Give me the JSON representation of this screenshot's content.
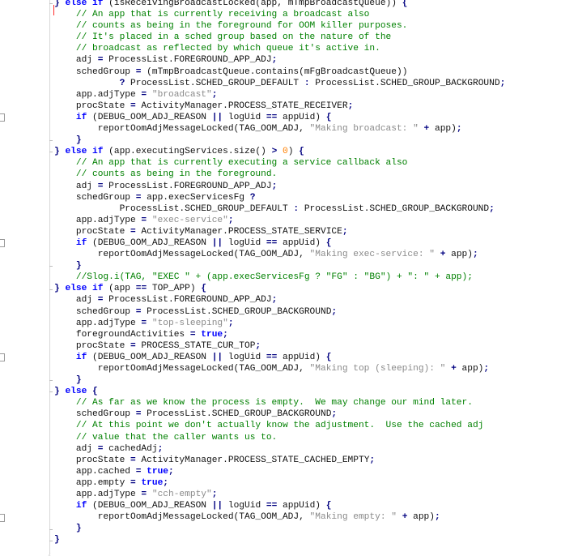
{
  "editor": {
    "gutter_markers": [
      8,
      9,
      10,
      11,
      12,
      13,
      14
    ],
    "lines": [
      [
        [
          "pn",
          "} "
        ],
        [
          "kw",
          "else if"
        ],
        [
          "t",
          " (isReceivingBroadcastLocked(app, mTmpBroadcastQueue)) "
        ],
        [
          "pn",
          "{"
        ]
      ],
      [
        [
          "t",
          "    "
        ],
        [
          "cm",
          "// An app that is currently receiving a broadcast also"
        ]
      ],
      [
        [
          "t",
          "    "
        ],
        [
          "cm",
          "// counts as being in the foreground for OOM killer purposes."
        ]
      ],
      [
        [
          "t",
          "    "
        ],
        [
          "cm",
          "// It's placed in a sched group based on the nature of the"
        ]
      ],
      [
        [
          "t",
          "    "
        ],
        [
          "cm",
          "// broadcast as reflected by which queue it's active in."
        ]
      ],
      [
        [
          "t",
          "    adj "
        ],
        [
          "pn",
          "="
        ],
        [
          "t",
          " ProcessList.FOREGROUND_APP_ADJ"
        ],
        [
          "pn",
          ";"
        ]
      ],
      [
        [
          "t",
          "    schedGroup "
        ],
        [
          "pn",
          "="
        ],
        [
          "t",
          " (mTmpBroadcastQueue.contains(mFgBroadcastQueue))"
        ]
      ],
      [
        [
          "t",
          "            "
        ],
        [
          "pn",
          "?"
        ],
        [
          "t",
          " ProcessList.SCHED_GROUP_DEFAULT "
        ],
        [
          "pn",
          ":"
        ],
        [
          "t",
          " ProcessList.SCHED_GROUP_BACKGROUND"
        ],
        [
          "pn",
          ";"
        ]
      ],
      [
        [
          "t",
          "    app.adjType "
        ],
        [
          "pn",
          "="
        ],
        [
          "t",
          " "
        ],
        [
          "str",
          "\"broadcast\""
        ],
        [
          "pn",
          ";"
        ]
      ],
      [
        [
          "t",
          "    procState "
        ],
        [
          "pn",
          "="
        ],
        [
          "t",
          " ActivityManager.PROCESS_STATE_RECEIVER"
        ],
        [
          "pn",
          ";"
        ]
      ],
      [
        [
          "t",
          "    "
        ],
        [
          "kw",
          "if"
        ],
        [
          "t",
          " (DEBUG_OOM_ADJ_REASON "
        ],
        [
          "pn",
          "||"
        ],
        [
          "t",
          " logUid "
        ],
        [
          "pn",
          "=="
        ],
        [
          "t",
          " appUid) "
        ],
        [
          "pn",
          "{"
        ]
      ],
      [
        [
          "t",
          "        reportOomAdjMessageLocked(TAG_OOM_ADJ, "
        ],
        [
          "str",
          "\"Making broadcast: \""
        ],
        [
          "t",
          " "
        ],
        [
          "pn",
          "+"
        ],
        [
          "t",
          " app)"
        ],
        [
          "pn",
          ";"
        ]
      ],
      [
        [
          "t",
          "    "
        ],
        [
          "pn",
          "}"
        ]
      ],
      [
        [
          "pn",
          "} "
        ],
        [
          "kw",
          "else if"
        ],
        [
          "t",
          " (app.executingServices.size() "
        ],
        [
          "pn",
          ">"
        ],
        [
          "t",
          " "
        ],
        [
          "num",
          "0"
        ],
        [
          "t",
          ") "
        ],
        [
          "pn",
          "{"
        ]
      ],
      [
        [
          "t",
          "    "
        ],
        [
          "cm",
          "// An app that is currently executing a service callback also"
        ]
      ],
      [
        [
          "t",
          "    "
        ],
        [
          "cm",
          "// counts as being in the foreground."
        ]
      ],
      [
        [
          "t",
          "    adj "
        ],
        [
          "pn",
          "="
        ],
        [
          "t",
          " ProcessList.FOREGROUND_APP_ADJ"
        ],
        [
          "pn",
          ";"
        ]
      ],
      [
        [
          "t",
          "    schedGroup "
        ],
        [
          "pn",
          "="
        ],
        [
          "t",
          " app.execServicesFg "
        ],
        [
          "pn",
          "?"
        ]
      ],
      [
        [
          "t",
          "            ProcessList.SCHED_GROUP_DEFAULT "
        ],
        [
          "pn",
          ":"
        ],
        [
          "t",
          " ProcessList.SCHED_GROUP_BACKGROUND"
        ],
        [
          "pn",
          ";"
        ]
      ],
      [
        [
          "t",
          "    app.adjType "
        ],
        [
          "pn",
          "="
        ],
        [
          "t",
          " "
        ],
        [
          "str",
          "\"exec-service\""
        ],
        [
          "pn",
          ";"
        ]
      ],
      [
        [
          "t",
          "    procState "
        ],
        [
          "pn",
          "="
        ],
        [
          "t",
          " ActivityManager.PROCESS_STATE_SERVICE"
        ],
        [
          "pn",
          ";"
        ]
      ],
      [
        [
          "t",
          "    "
        ],
        [
          "kw",
          "if"
        ],
        [
          "t",
          " (DEBUG_OOM_ADJ_REASON "
        ],
        [
          "pn",
          "||"
        ],
        [
          "t",
          " logUid "
        ],
        [
          "pn",
          "=="
        ],
        [
          "t",
          " appUid) "
        ],
        [
          "pn",
          "{"
        ]
      ],
      [
        [
          "t",
          "        reportOomAdjMessageLocked(TAG_OOM_ADJ, "
        ],
        [
          "str",
          "\"Making exec-service: \""
        ],
        [
          "t",
          " "
        ],
        [
          "pn",
          "+"
        ],
        [
          "t",
          " app)"
        ],
        [
          "pn",
          ";"
        ]
      ],
      [
        [
          "t",
          "    "
        ],
        [
          "pn",
          "}"
        ]
      ],
      [
        [
          "t",
          "    "
        ],
        [
          "cm",
          "//Slog.i(TAG, \"EXEC \" + (app.execServicesFg ? \"FG\" : \"BG\") + \": \" + app);"
        ]
      ],
      [
        [
          "pn",
          "} "
        ],
        [
          "kw",
          "else if"
        ],
        [
          "t",
          " (app "
        ],
        [
          "pn",
          "=="
        ],
        [
          "t",
          " TOP_APP) "
        ],
        [
          "pn",
          "{"
        ]
      ],
      [
        [
          "t",
          "    adj "
        ],
        [
          "pn",
          "="
        ],
        [
          "t",
          " ProcessList.FOREGROUND_APP_ADJ"
        ],
        [
          "pn",
          ";"
        ]
      ],
      [
        [
          "t",
          "    schedGroup "
        ],
        [
          "pn",
          "="
        ],
        [
          "t",
          " ProcessList.SCHED_GROUP_BACKGROUND"
        ],
        [
          "pn",
          ";"
        ]
      ],
      [
        [
          "t",
          "    app.adjType "
        ],
        [
          "pn",
          "="
        ],
        [
          "t",
          " "
        ],
        [
          "str",
          "\"top-sleeping\""
        ],
        [
          "pn",
          ";"
        ]
      ],
      [
        [
          "t",
          "    foregroundActivities "
        ],
        [
          "pn",
          "="
        ],
        [
          "t",
          " "
        ],
        [
          "kw",
          "true"
        ],
        [
          "pn",
          ";"
        ]
      ],
      [
        [
          "t",
          "    procState "
        ],
        [
          "pn",
          "="
        ],
        [
          "t",
          " PROCESS_STATE_CUR_TOP"
        ],
        [
          "pn",
          ";"
        ]
      ],
      [
        [
          "t",
          "    "
        ],
        [
          "kw",
          "if"
        ],
        [
          "t",
          " (DEBUG_OOM_ADJ_REASON "
        ],
        [
          "pn",
          "||"
        ],
        [
          "t",
          " logUid "
        ],
        [
          "pn",
          "=="
        ],
        [
          "t",
          " appUid) "
        ],
        [
          "pn",
          "{"
        ]
      ],
      [
        [
          "t",
          "        reportOomAdjMessageLocked(TAG_OOM_ADJ, "
        ],
        [
          "str",
          "\"Making top (sleeping): \""
        ],
        [
          "t",
          " "
        ],
        [
          "pn",
          "+"
        ],
        [
          "t",
          " app)"
        ],
        [
          "pn",
          ";"
        ]
      ],
      [
        [
          "t",
          "    "
        ],
        [
          "pn",
          "}"
        ]
      ],
      [
        [
          "pn",
          "} "
        ],
        [
          "kw",
          "else"
        ],
        [
          "t",
          " "
        ],
        [
          "pn",
          "{"
        ]
      ],
      [
        [
          "t",
          "    "
        ],
        [
          "cm",
          "// As far as we know the process is empty.  We may change our mind later."
        ]
      ],
      [
        [
          "t",
          "    schedGroup "
        ],
        [
          "pn",
          "="
        ],
        [
          "t",
          " ProcessList.SCHED_GROUP_BACKGROUND"
        ],
        [
          "pn",
          ";"
        ]
      ],
      [
        [
          "t",
          "    "
        ],
        [
          "cm",
          "// At this point we don't actually know the adjustment.  Use the cached adj"
        ]
      ],
      [
        [
          "t",
          "    "
        ],
        [
          "cm",
          "// value that the caller wants us to."
        ]
      ],
      [
        [
          "t",
          "    adj "
        ],
        [
          "pn",
          "="
        ],
        [
          "t",
          " cachedAdj"
        ],
        [
          "pn",
          ";"
        ]
      ],
      [
        [
          "t",
          "    procState "
        ],
        [
          "pn",
          "="
        ],
        [
          "t",
          " ActivityManager.PROCESS_STATE_CACHED_EMPTY"
        ],
        [
          "pn",
          ";"
        ]
      ],
      [
        [
          "t",
          "    app.cached "
        ],
        [
          "pn",
          "="
        ],
        [
          "t",
          " "
        ],
        [
          "kw",
          "true"
        ],
        [
          "pn",
          ";"
        ]
      ],
      [
        [
          "t",
          "    app.empty "
        ],
        [
          "pn",
          "="
        ],
        [
          "t",
          " "
        ],
        [
          "kw",
          "true"
        ],
        [
          "pn",
          ";"
        ]
      ],
      [
        [
          "t",
          "    app.adjType "
        ],
        [
          "pn",
          "="
        ],
        [
          "t",
          " "
        ],
        [
          "str",
          "\"cch-empty\""
        ],
        [
          "pn",
          ";"
        ]
      ],
      [
        [
          "t",
          "    "
        ],
        [
          "kw",
          "if"
        ],
        [
          "t",
          " (DEBUG_OOM_ADJ_REASON "
        ],
        [
          "pn",
          "||"
        ],
        [
          "t",
          " logUid "
        ],
        [
          "pn",
          "=="
        ],
        [
          "t",
          " appUid) "
        ],
        [
          "pn",
          "{"
        ]
      ],
      [
        [
          "t",
          "        reportOomAdjMessageLocked(TAG_OOM_ADJ, "
        ],
        [
          "str",
          "\"Making empty: \""
        ],
        [
          "t",
          " "
        ],
        [
          "pn",
          "+"
        ],
        [
          "t",
          " app)"
        ],
        [
          "pn",
          ";"
        ]
      ],
      [
        [
          "t",
          "    "
        ],
        [
          "pn",
          "}"
        ]
      ],
      [
        [
          "pn",
          "}"
        ]
      ]
    ]
  }
}
